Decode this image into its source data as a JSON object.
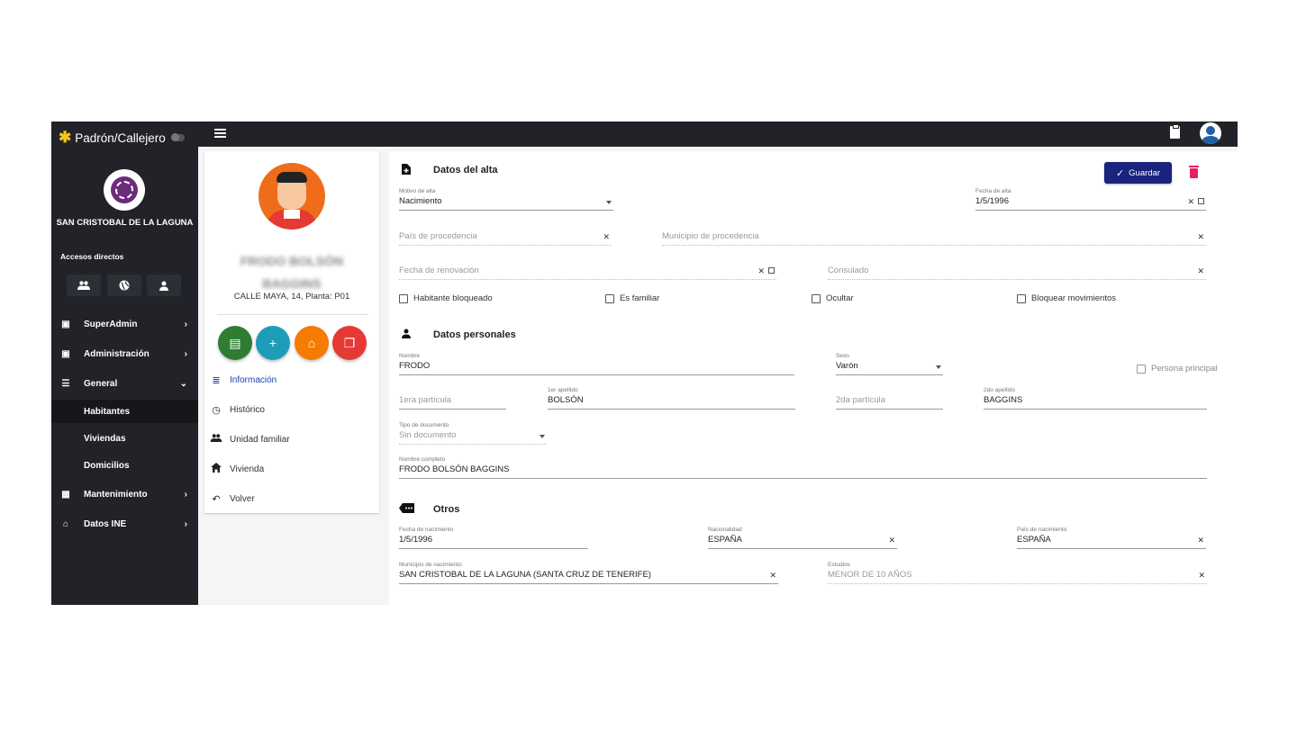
{
  "sidebar": {
    "brand_title": "Padrón/Callejero",
    "municipality": "SAN CRISTOBAL DE LA LAGUNA",
    "accesos_label": "Accesos directos",
    "nav": [
      {
        "label": "SuperAdmin",
        "chevron": ">"
      },
      {
        "label": "Administración",
        "chevron": ">"
      },
      {
        "label": "General",
        "chevron": "v"
      },
      {
        "label": "Mantenimiento",
        "chevron": ">"
      },
      {
        "label": "Datos INE",
        "chevron": ">"
      }
    ],
    "sub": [
      {
        "label": "Habitantes"
      },
      {
        "label": "Viviendas"
      },
      {
        "label": "Domicilios"
      }
    ]
  },
  "profile": {
    "name_line1": "FRODO BOLSÓN",
    "name_line2": "BAGGINS",
    "address": "CALLE MAYA, 14, Planta: P01",
    "fab_colors": [
      "#2e7d32",
      "#1e9db8",
      "#f57c00",
      "#e53935"
    ],
    "menu": [
      {
        "label": "Información",
        "icon": "list-icon"
      },
      {
        "label": "Histórico",
        "icon": "history-icon"
      },
      {
        "label": "Unidad familiar",
        "icon": "people-icon"
      },
      {
        "label": "Vivienda",
        "icon": "home-icon"
      },
      {
        "label": "Volver",
        "icon": "undo-icon"
      }
    ]
  },
  "form": {
    "save_label": "Guardar",
    "alta": {
      "title": "Datos del alta",
      "motivo_label": "Motivo de alta",
      "motivo_value": "Nacimiento",
      "fecha_alta_label": "Fecha de alta",
      "fecha_alta_value": "1/5/1996",
      "pais_procedencia": "País de procedencia",
      "municipio_procedencia": "Municipio de procedencia",
      "fecha_renovacion": "Fecha de renovación",
      "consulado": "Consulado",
      "chk_bloqueado": "Habitante bloqueado",
      "chk_familiar": "Es familiar",
      "chk_ocultar": "Ocultar",
      "chk_bloquear_mov": "Bloquear movimientos"
    },
    "personales": {
      "title": "Datos personales",
      "nombre_label": "Nombre",
      "nombre_value": "FRODO",
      "sexo_label": "Sexo",
      "sexo_value": "Varón",
      "persona_principal": "Persona principal",
      "particula1": "1era partícula",
      "apellido1_label": "1er apellido",
      "apellido1_value": "BOLSÓN",
      "particula2": "2da partícula",
      "apellido2_label": "2do apellido",
      "apellido2_value": "BAGGINS",
      "tipo_doc_label": "Tipo de documento",
      "tipo_doc_value": "Sin documento",
      "nombre_completo_label": "Nombre completo",
      "nombre_completo_value": "FRODO BOLSÓN BAGGINS"
    },
    "otros": {
      "title": "Otros",
      "fecha_nac_label": "Fecha de nacimiento",
      "fecha_nac_value": "1/5/1996",
      "nacionalidad_label": "Nacionalidad",
      "nacionalidad_value": "ESPAÑA",
      "pais_nac_label": "País de nacimiento",
      "pais_nac_value": "ESPAÑA",
      "municipio_nac_label": "Municipio de nacimiento",
      "municipio_nac_value": "SAN CRISTOBAL DE LA LAGUNA (SANTA CRUZ DE TENERIFE)",
      "estudios_label": "Estudios",
      "estudios_value": "MENOR DE 10 AÑOS"
    }
  }
}
